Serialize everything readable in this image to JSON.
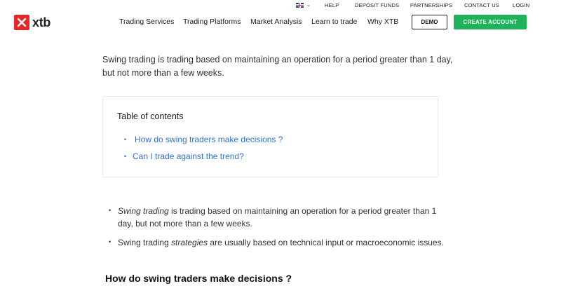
{
  "utility_bar": {
    "help": "HELP",
    "deposit": "DEPOSIT FUNDS",
    "partnerships": "PARTNERSHIPS",
    "contact": "CONTACT US",
    "login": "LOGIN"
  },
  "header": {
    "logo_text": "xtb",
    "nav": [
      "Trading Services",
      "Trading Platforms",
      "Market Analysis",
      "Learn to trade",
      "Why XTB"
    ],
    "demo_label": "DEMO",
    "create_label": "CREATE ACCOUNT"
  },
  "colors": {
    "brand_red": "#e8262a",
    "cta_green": "#1fb25a",
    "link_blue": "#2f6fd6"
  },
  "content": {
    "intro": "Swing trading is trading based on maintaining an operation for a period greater than 1 day, but not more than a few weeks.",
    "toc": {
      "title": "Table of contents",
      "items": [
        "How do swing traders make decisions ?",
        "Can I trade against the trend?"
      ]
    },
    "bullets": [
      {
        "em": "Swing trading",
        "rest": " is trading based on maintaining an operation for a period greater than 1 day, but not more than a few weeks."
      },
      {
        "pre": "Swing trading ",
        "em": "strategies",
        "rest": " are usually based on technical input or macroeconomic issues."
      }
    ],
    "heading": "How do swing traders make decisions ?"
  }
}
